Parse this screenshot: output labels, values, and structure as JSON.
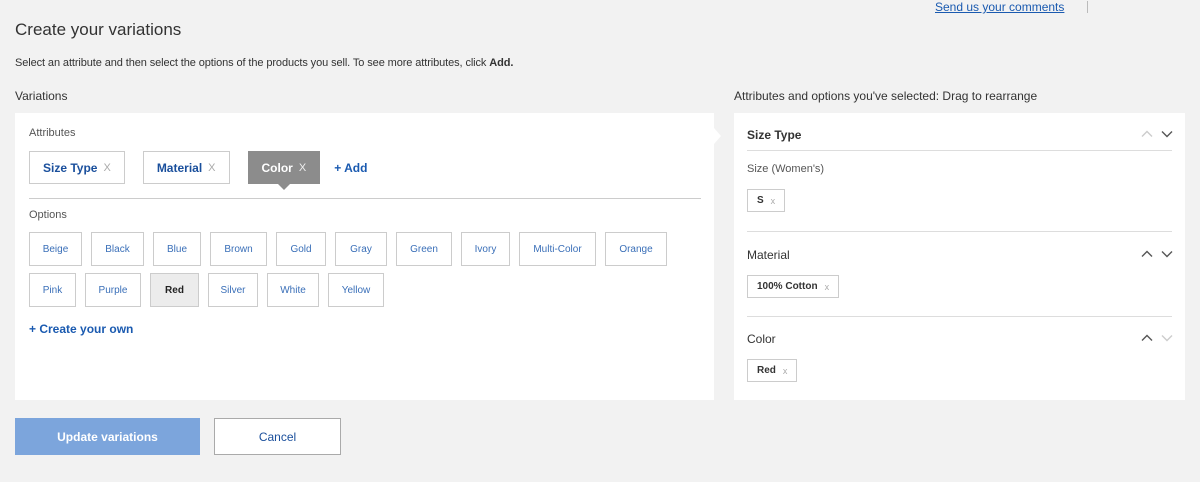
{
  "header": {
    "feedback_link": "Send us your comments",
    "title": "Create your variations",
    "instructions_prefix": "Select an attribute and then select the options of the products you sell. To see more attributes, click ",
    "instructions_bold": "Add."
  },
  "variations": {
    "label": "Variations",
    "attributes_label": "Attributes",
    "attributes": [
      {
        "label": "Size Type",
        "remove": "X",
        "active": false
      },
      {
        "label": "Material",
        "remove": "X",
        "active": false
      },
      {
        "label": "Color",
        "remove": "X",
        "active": true
      }
    ],
    "add_label": "+ Add",
    "options_label": "Options",
    "options_rows": [
      [
        "Beige",
        "Black",
        "Blue",
        "Brown",
        "Gold",
        "Gray",
        "Green",
        "Ivory",
        "Multi-Color",
        "Orange"
      ],
      [
        "Pink",
        "Purple",
        "Red",
        "Silver",
        "White",
        "Yellow"
      ]
    ],
    "selected_option": "Red",
    "create_own": "+ Create your own"
  },
  "selected": {
    "label": "Attributes and options you've selected: Drag to rearrange",
    "groups": [
      {
        "title": "Size Type",
        "subname": "Size (Women's)",
        "values": [
          "S"
        ]
      },
      {
        "title": "Material",
        "subname": "",
        "values": [
          "100% Cotton"
        ]
      },
      {
        "title": "Color",
        "subname": "",
        "values": [
          "Red"
        ]
      }
    ],
    "remove": "x"
  },
  "actions": {
    "update": "Update variations",
    "cancel": "Cancel"
  },
  "colors": {
    "link": "#1a5ab0",
    "primary_button": "#7ca5dc",
    "active_chip": "#8c8c8c"
  }
}
